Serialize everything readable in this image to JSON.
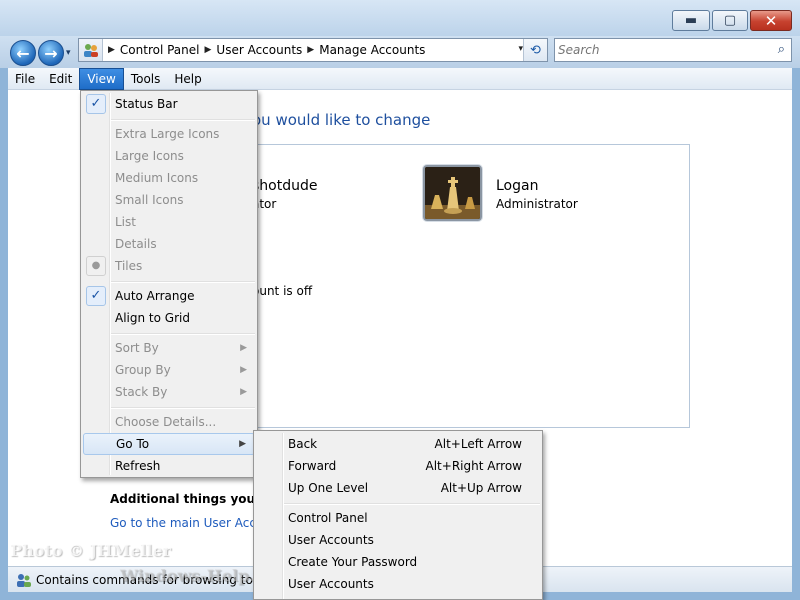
{
  "window": {
    "minimize_glyph": "▬",
    "maximize_glyph": "▢",
    "close_glyph": "✕"
  },
  "navigation": {
    "back_glyph": "←",
    "forward_glyph": "→",
    "dropdown_glyph": "▾"
  },
  "address": {
    "breadcrumb": [
      "Control Panel",
      "User Accounts",
      "Manage Accounts"
    ],
    "separator": "▶",
    "dropdown_glyph": "▾",
    "refresh_glyph": "⟲"
  },
  "search": {
    "placeholder": "Search",
    "icon": "search-icon"
  },
  "menubar": {
    "items": [
      "File",
      "Edit",
      "View",
      "Tools",
      "Help"
    ],
    "open_item": "View"
  },
  "main": {
    "heading": "ou would like to change",
    "accounts": [
      {
        "name": "shotdude",
        "type": "ator"
      },
      {
        "name": "Logan",
        "type": "Administrator"
      }
    ],
    "guest_text": "ount is off",
    "additional_heading": "Additional things you can d",
    "link_goto": "Go to the main User Accou"
  },
  "view_menu": {
    "items": [
      {
        "label": "Status Bar",
        "state": "checked"
      },
      {
        "label": "Extra Large Icons",
        "state": "disabled"
      },
      {
        "label": "Large Icons",
        "state": "disabled"
      },
      {
        "label": "Medium Icons",
        "state": "disabled"
      },
      {
        "label": "Small Icons",
        "state": "disabled"
      },
      {
        "label": "List",
        "state": "disabled"
      },
      {
        "label": "Details",
        "state": "disabled"
      },
      {
        "label": "Tiles",
        "state": "disabled-radio"
      },
      {
        "label": "Auto Arrange",
        "state": "checked"
      },
      {
        "label": "Align to Grid",
        "state": "normal"
      },
      {
        "label": "Sort By",
        "state": "disabled-submenu"
      },
      {
        "label": "Group By",
        "state": "disabled-submenu"
      },
      {
        "label": "Stack By",
        "state": "disabled-submenu"
      },
      {
        "label": "Choose Details...",
        "state": "disabled"
      },
      {
        "label": "Go To",
        "state": "hover-submenu"
      },
      {
        "label": "Refresh",
        "state": "normal"
      }
    ],
    "check_glyph": "✓",
    "radio_glyph": "●",
    "submenu_glyph": "▶"
  },
  "goto_menu": {
    "items": [
      {
        "label": "Back",
        "shortcut": "Alt+Left Arrow"
      },
      {
        "label": "Forward",
        "shortcut": "Alt+Right Arrow"
      },
      {
        "label": "Up One Level",
        "shortcut": "Alt+Up Arrow"
      },
      {
        "label": "Control Panel",
        "shortcut": ""
      },
      {
        "label": "User Accounts",
        "shortcut": ""
      },
      {
        "label": "Create Your Password",
        "shortcut": ""
      },
      {
        "label": "User Accounts",
        "shortcut": ""
      }
    ]
  },
  "statusbar": {
    "text": "Contains commands for browsing to vari"
  },
  "watermark": {
    "line1": "Photo © JHMeller",
    "line2": "Windows-Help.Net"
  },
  "colors": {
    "accent_blue": "#1e4f9e",
    "link_blue": "#1e5bbd",
    "menu_open": "#1f6dc8",
    "close_red": "#c7422f"
  }
}
